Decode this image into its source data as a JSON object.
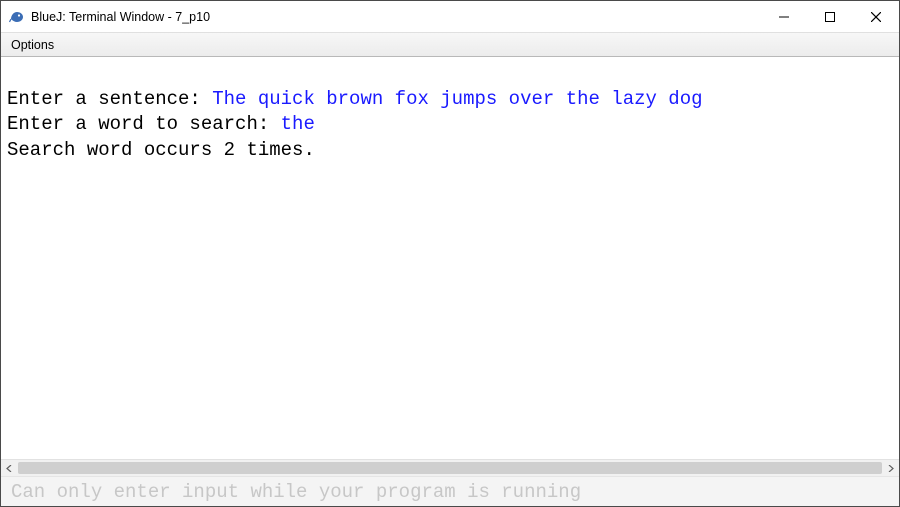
{
  "window": {
    "title": "BlueJ: Terminal Window - 7_p10"
  },
  "menu": {
    "options": "Options"
  },
  "terminal": {
    "line1_prompt": "Enter a sentence: ",
    "line1_input": "The quick brown fox jumps over the lazy dog",
    "line2_prompt": "Enter a word to search: ",
    "line2_input": "the",
    "line3_output": "Search word occurs 2 times."
  },
  "input_bar": {
    "placeholder": "Can only enter input while your program is running"
  }
}
